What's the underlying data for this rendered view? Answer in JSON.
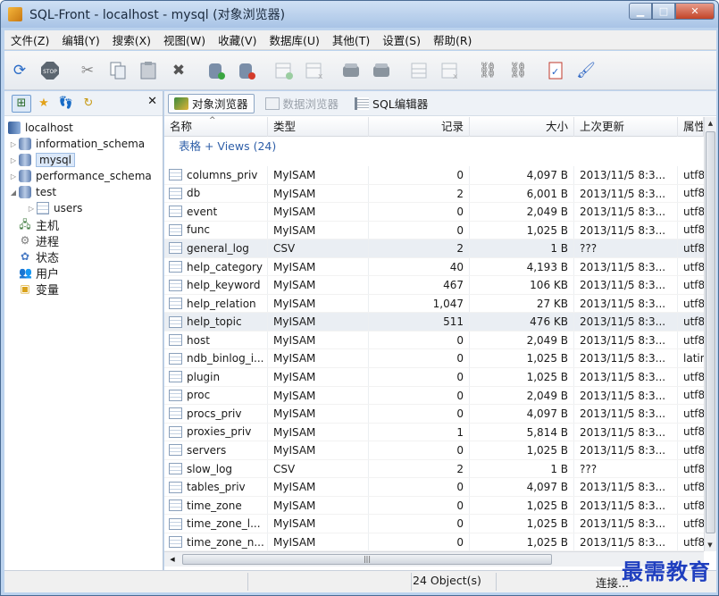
{
  "window": {
    "title": "SQL-Front - localhost - mysql  (对象浏览器)"
  },
  "menu": [
    "文件(Z)",
    "编辑(Y)",
    "搜索(X)",
    "视图(W)",
    "收藏(V)",
    "数据库(U)",
    "其他(T)",
    "设置(S)",
    "帮助(R)"
  ],
  "toolbar": {
    "icons": [
      "refresh-icon",
      "stop-icon",
      "cut-icon",
      "copy-icon",
      "paste-icon",
      "delete-icon",
      "new-database-icon",
      "drop-database-icon",
      "new-table-icon",
      "drop-table-icon",
      "import-icon",
      "export-icon",
      "new-row-icon",
      "delete-row-icon",
      "link-icon",
      "unlink-icon",
      "checklist-icon",
      "brush-icon"
    ]
  },
  "tree": {
    "nodes": [
      {
        "label": "localhost",
        "type": "server",
        "level": 0
      },
      {
        "label": "information_schema",
        "type": "database",
        "level": 1
      },
      {
        "label": "mysql",
        "type": "database",
        "level": 1,
        "selected": true
      },
      {
        "label": "performance_schema",
        "type": "database",
        "level": 1
      },
      {
        "label": "test",
        "type": "database",
        "level": 1
      },
      {
        "label": "users",
        "type": "table",
        "level": 2
      },
      {
        "label": "主机",
        "type": "hosts",
        "level": 1
      },
      {
        "label": "进程",
        "type": "processes",
        "level": 1
      },
      {
        "label": "状态",
        "type": "status",
        "level": 1
      },
      {
        "label": "用户",
        "type": "users",
        "level": 1
      },
      {
        "label": "变量",
        "type": "variables",
        "level": 1
      }
    ]
  },
  "tabs": {
    "object_browser": "对象浏览器",
    "data_browser": "数据浏览器",
    "sql_editor": "SQL编辑器"
  },
  "columns": [
    "名称",
    "类型",
    "记录",
    "大小",
    "上次更新",
    "属性"
  ],
  "group_label": "表格 + Views (24)",
  "rows": [
    {
      "name": "columns_priv",
      "type": "MyISAM",
      "records": "0",
      "size": "4,097 B",
      "updated": "2013/11/5 8:3...",
      "attr": "utf8"
    },
    {
      "name": "db",
      "type": "MyISAM",
      "records": "2",
      "size": "6,001 B",
      "updated": "2013/11/5 8:3...",
      "attr": "utf8"
    },
    {
      "name": "event",
      "type": "MyISAM",
      "records": "0",
      "size": "2,049 B",
      "updated": "2013/11/5 8:3...",
      "attr": "utf8"
    },
    {
      "name": "func",
      "type": "MyISAM",
      "records": "0",
      "size": "1,025 B",
      "updated": "2013/11/5 8:3...",
      "attr": "utf8"
    },
    {
      "name": "general_log",
      "type": "CSV",
      "records": "2",
      "size": "1 B",
      "updated": "???",
      "attr": "utf8"
    },
    {
      "name": "help_category",
      "type": "MyISAM",
      "records": "40",
      "size": "4,193 B",
      "updated": "2013/11/5 8:3...",
      "attr": "utf8"
    },
    {
      "name": "help_keyword",
      "type": "MyISAM",
      "records": "467",
      "size": "106 KB",
      "updated": "2013/11/5 8:3...",
      "attr": "utf8"
    },
    {
      "name": "help_relation",
      "type": "MyISAM",
      "records": "1,047",
      "size": "27 KB",
      "updated": "2013/11/5 8:3...",
      "attr": "utf8"
    },
    {
      "name": "help_topic",
      "type": "MyISAM",
      "records": "511",
      "size": "476 KB",
      "updated": "2013/11/5 8:3...",
      "attr": "utf8"
    },
    {
      "name": "host",
      "type": "MyISAM",
      "records": "0",
      "size": "2,049 B",
      "updated": "2013/11/5 8:3...",
      "attr": "utf8"
    },
    {
      "name": "ndb_binlog_i...",
      "type": "MyISAM",
      "records": "0",
      "size": "1,025 B",
      "updated": "2013/11/5 8:3...",
      "attr": "latin"
    },
    {
      "name": "plugin",
      "type": "MyISAM",
      "records": "0",
      "size": "1,025 B",
      "updated": "2013/11/5 8:3...",
      "attr": "utf8"
    },
    {
      "name": "proc",
      "type": "MyISAM",
      "records": "0",
      "size": "2,049 B",
      "updated": "2013/11/5 8:3...",
      "attr": "utf8"
    },
    {
      "name": "procs_priv",
      "type": "MyISAM",
      "records": "0",
      "size": "4,097 B",
      "updated": "2013/11/5 8:3...",
      "attr": "utf8"
    },
    {
      "name": "proxies_priv",
      "type": "MyISAM",
      "records": "1",
      "size": "5,814 B",
      "updated": "2013/11/5 8:3...",
      "attr": "utf8"
    },
    {
      "name": "servers",
      "type": "MyISAM",
      "records": "0",
      "size": "1,025 B",
      "updated": "2013/11/5 8:3...",
      "attr": "utf8"
    },
    {
      "name": "slow_log",
      "type": "CSV",
      "records": "2",
      "size": "1 B",
      "updated": "???",
      "attr": "utf8"
    },
    {
      "name": "tables_priv",
      "type": "MyISAM",
      "records": "0",
      "size": "4,097 B",
      "updated": "2013/11/5 8:3...",
      "attr": "utf8"
    },
    {
      "name": "time_zone",
      "type": "MyISAM",
      "records": "0",
      "size": "1,025 B",
      "updated": "2013/11/5 8:3...",
      "attr": "utf8"
    },
    {
      "name": "time_zone_l...",
      "type": "MyISAM",
      "records": "0",
      "size": "1,025 B",
      "updated": "2013/11/5 8:3...",
      "attr": "utf8"
    },
    {
      "name": "time_zone_n...",
      "type": "MyISAM",
      "records": "0",
      "size": "1,025 B",
      "updated": "2013/11/5 8:3...",
      "attr": "utf8"
    }
  ],
  "status": {
    "count": "24 Object(s)",
    "right": "连接..."
  },
  "watermark": "最需教育"
}
